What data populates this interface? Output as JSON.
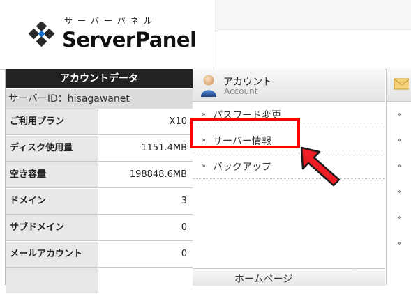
{
  "logo": {
    "subtitle": "サーバーパネル",
    "title": "ServerPanel"
  },
  "account_data": {
    "title": "アカウントデータ",
    "server_id": "サーバーID：hisagawanet",
    "rows": [
      {
        "label": "ご利用プラン",
        "value": "X10"
      },
      {
        "label": "ディスク使用量",
        "value": "1151.4MB"
      },
      {
        "label": "空き容量",
        "value": "198848.6MB"
      },
      {
        "label": "ドメイン",
        "value": "3"
      },
      {
        "label": "サブドメイン",
        "value": "0"
      },
      {
        "label": "メールアカウント",
        "value": "0"
      }
    ]
  },
  "account_menu": {
    "title": "アカウント",
    "subtitle": "Account",
    "items": [
      {
        "label": "パスワード変更"
      },
      {
        "label": "サーバー情報"
      },
      {
        "label": "バックアップ"
      }
    ]
  },
  "next_section": {
    "label": "ホームページ"
  },
  "icons": {
    "logo": "diamond-logo-icon",
    "account": "user-icon",
    "menu_arrow": "double-arrow-icon",
    "highlight_arrow": "red-pointer-arrow-icon"
  },
  "colors": {
    "highlight": "#ff0000",
    "header_dark": "#222222"
  }
}
